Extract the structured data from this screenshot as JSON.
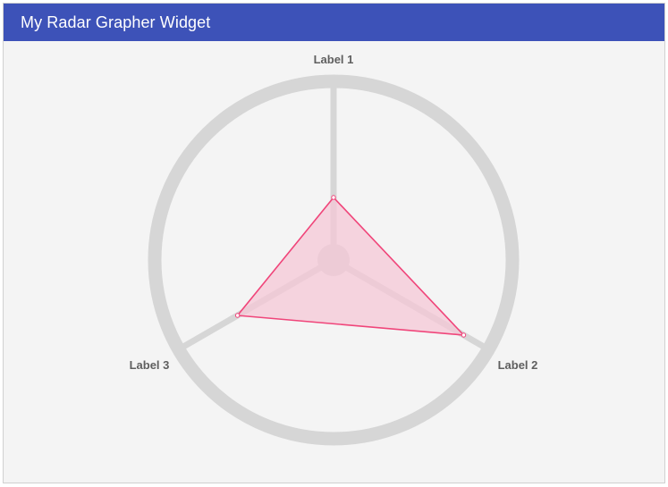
{
  "header": {
    "title": "My Radar Grapher Widget"
  },
  "colors": {
    "header_bg": "#3d52b8",
    "panel_bg": "#f4f4f4",
    "grid": "#d6d6d6",
    "series_stroke": "#f0457a",
    "series_fill": "#f5c6d6",
    "label": "#5f5f5f"
  },
  "chart_data": {
    "type": "radar",
    "axes": [
      "Label 1",
      "Label 2",
      "Label 3"
    ],
    "range": [
      0,
      1
    ],
    "series": [
      {
        "values": [
          0.35,
          0.84,
          0.62
        ]
      }
    ],
    "grid": true,
    "legend": "none"
  }
}
